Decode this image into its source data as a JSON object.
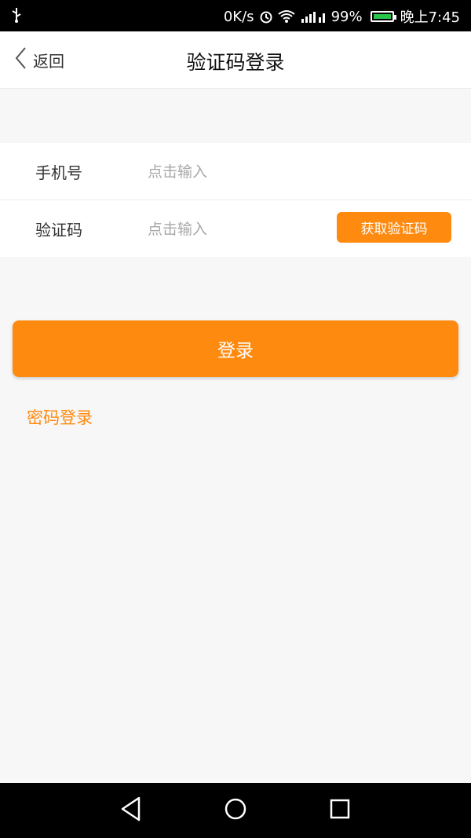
{
  "status_bar": {
    "speed": "0K/s",
    "battery": "99%",
    "time": "晚上7:45"
  },
  "nav": {
    "back_label": "返回",
    "title": "验证码登录"
  },
  "form": {
    "phone_label": "手机号",
    "phone_placeholder": "点击输入",
    "code_label": "验证码",
    "code_placeholder": "点击输入",
    "get_code_label": "获取验证码"
  },
  "actions": {
    "login_label": "登录",
    "password_login_label": "密码登录"
  },
  "colors": {
    "accent": "#ff8a10",
    "background": "#f7f7f7"
  },
  "icons": {
    "usb": "usb-icon",
    "alarm": "alarm-icon",
    "wifi": "wifi-icon",
    "signal": "signal-icon",
    "battery": "battery-icon",
    "back": "chevron-left-icon",
    "nav_back": "triangle-back-icon",
    "nav_home": "circle-home-icon",
    "nav_recent": "square-recent-icon"
  }
}
